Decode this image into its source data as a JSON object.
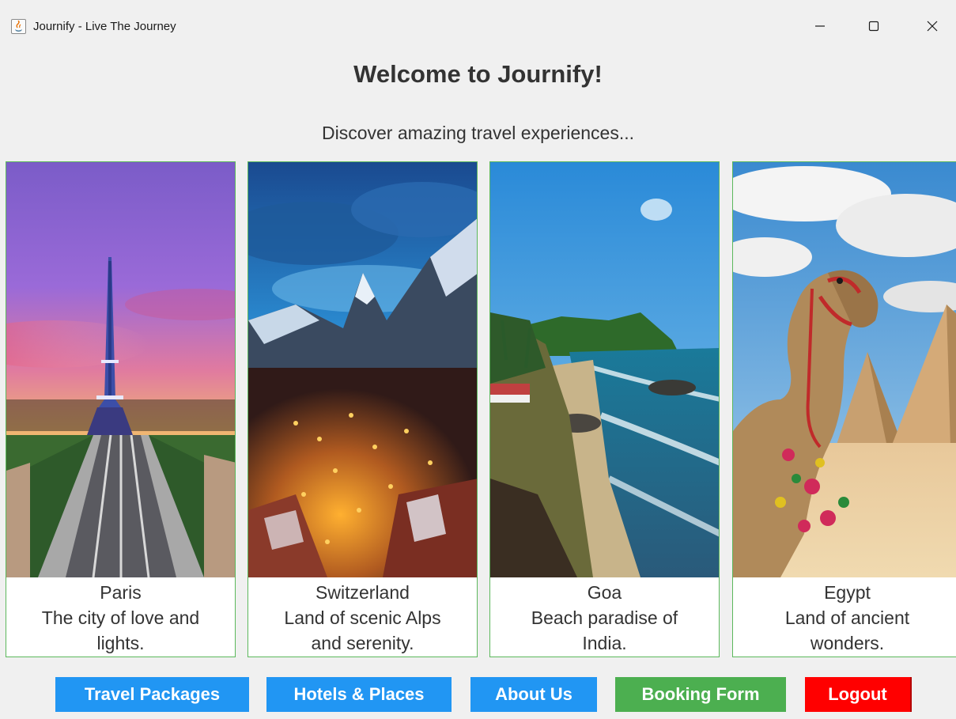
{
  "window": {
    "title": "Journify - Live The Journey"
  },
  "header": {
    "welcome": "Welcome to Journify!",
    "tagline": "Discover amazing travel experiences..."
  },
  "destinations": [
    {
      "name": "Paris",
      "line1": "The city of love and",
      "line2": "lights.",
      "image_icon": "eiffel-tower-photo"
    },
    {
      "name": "Switzerland",
      "line1": "Land of scenic Alps",
      "line2": "and serenity.",
      "image_icon": "alps-village-photo"
    },
    {
      "name": "Goa",
      "line1": "Beach paradise of",
      "line2": "India.",
      "image_icon": "beach-coast-photo"
    },
    {
      "name": "Egypt",
      "line1": "Land of ancient",
      "line2": "wonders.",
      "image_icon": "camel-pyramids-photo"
    }
  ],
  "buttons": {
    "travel_packages": "Travel Packages",
    "hotels_places": "Hotels & Places",
    "about_us": "About Us",
    "booking_form": "Booking Form",
    "logout": "Logout"
  },
  "colors": {
    "primary_button": "#2196f3",
    "booking_button": "#4caf50",
    "logout_button": "#ff0000",
    "card_border": "#5cb85c"
  }
}
